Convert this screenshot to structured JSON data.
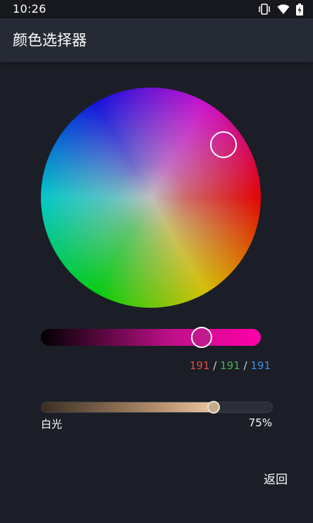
{
  "status_bar": {
    "time": "10:26",
    "icons": [
      "vibrate-icon",
      "wifi-icon",
      "battery-charging-icon"
    ]
  },
  "app_bar": {
    "title": "颜色选择器"
  },
  "color_wheel": {
    "selected_color": "#bf40bf"
  },
  "hue_slider": {
    "position": 0.73,
    "end_color": "#ff00a8"
  },
  "rgb": {
    "r": "191",
    "g": "191",
    "b": "191",
    "separator": " / "
  },
  "white_light": {
    "label": "白光",
    "value": "75%",
    "fraction": 0.75
  },
  "actions": {
    "back_label": "返回"
  },
  "colors": {
    "background": "#1b1e26",
    "app_bar": "#262a34",
    "r": "#e24a4a",
    "g": "#4caf50",
    "b": "#3f8fe0"
  }
}
